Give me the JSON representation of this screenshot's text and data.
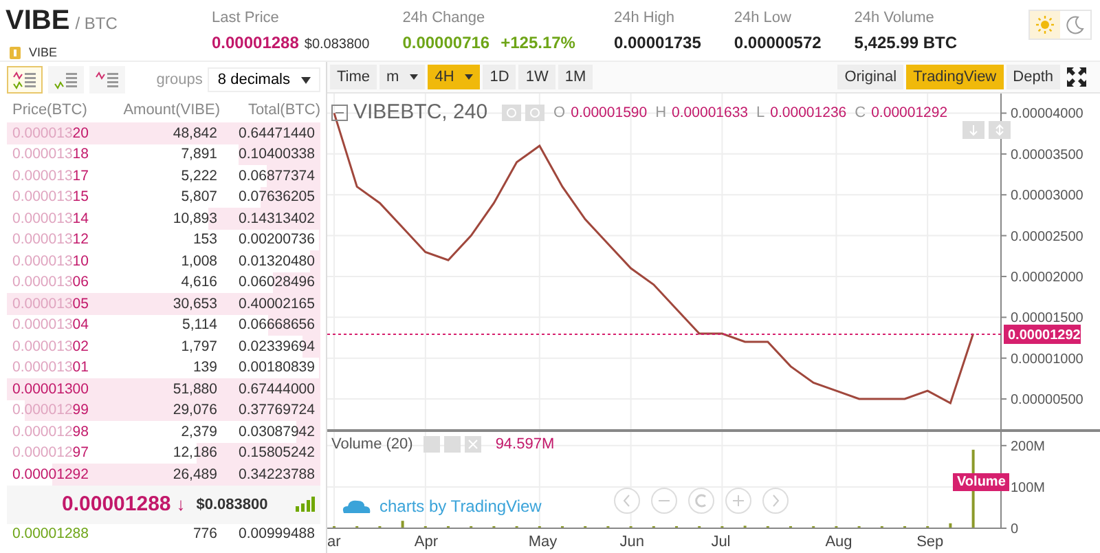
{
  "market": {
    "symbol": "VIBE",
    "quote": "/ BTC",
    "name": "VIBE"
  },
  "stats": [
    {
      "label": "Last Price",
      "value": "0.00001288",
      "extra": "$0.083800",
      "kind": "last"
    },
    {
      "label": "24h Change",
      "value": "0.00000716",
      "extra": "+125.17%",
      "kind": "change"
    },
    {
      "label": "24h High",
      "value": "0.00001735",
      "kind": "plain"
    },
    {
      "label": "24h Low",
      "value": "0.00000572",
      "kind": "plain"
    },
    {
      "label": "24h Volume",
      "value": "5,425.99 BTC",
      "kind": "plain"
    }
  ],
  "theme": [
    {
      "kind": "sun",
      "selected": true
    },
    {
      "kind": "moon",
      "selected": false
    }
  ],
  "orderbook": {
    "views": [
      {
        "kind": "both",
        "selected": true
      },
      {
        "kind": "buy",
        "selected": false
      },
      {
        "kind": "sell",
        "selected": false
      }
    ],
    "groups_label": "groups",
    "groups_value": "8 decimals",
    "columns": [
      "Price(BTC)",
      "Amount(VIBE)",
      "Total(BTC)"
    ],
    "asks": [
      {
        "price": "0.000013**20**",
        "amount": "48,842",
        "total": "0.64471440",
        "highlight": false
      },
      {
        "price": "0.000013**18**",
        "amount": "7,891",
        "total": "0.10400338",
        "highlight": false
      },
      {
        "price": "0.000013**17**",
        "amount": "5,222",
        "total": "0.06877374",
        "highlight": false
      },
      {
        "price": "0.000013**15**",
        "amount": "5,807",
        "total": "0.07636205",
        "highlight": false
      },
      {
        "price": "0.000013**14**",
        "amount": "10,893",
        "total": "0.14313402",
        "highlight": false
      },
      {
        "price": "0.000013**12**",
        "amount": "153",
        "total": "0.00200736",
        "highlight": false
      },
      {
        "price": "0.000013**10**",
        "amount": "1,008",
        "total": "0.01320480",
        "highlight": false
      },
      {
        "price": "0.000013**06**",
        "amount": "4,616",
        "total": "0.06028496",
        "highlight": false
      },
      {
        "price": "0.000013**05**",
        "amount": "30,653",
        "total": "0.40002165",
        "highlight": false
      },
      {
        "price": "0.000013**04**",
        "amount": "5,114",
        "total": "0.06668656",
        "highlight": false
      },
      {
        "price": "0.000013**02**",
        "amount": "1,797",
        "total": "0.02339694",
        "highlight": false
      },
      {
        "price": "0.000013**01**",
        "amount": "139",
        "total": "0.00180839",
        "highlight": false
      },
      {
        "price": "0.00001300",
        "amount": "51,880",
        "total": "0.67444000",
        "highlight": true
      },
      {
        "price": "0.000012**99**",
        "amount": "29,076",
        "total": "0.37769724",
        "highlight": false
      },
      {
        "price": "0.000012**98**",
        "amount": "2,379",
        "total": "0.03087942",
        "highlight": false
      },
      {
        "price": "0.000012**97**",
        "amount": "12,186",
        "total": "0.15805242",
        "highlight": false
      },
      {
        "price": "0.00001292",
        "amount": "26,489",
        "total": "0.34223788",
        "highlight": true
      }
    ],
    "last_price": "0.00001288",
    "arrow": "↓",
    "last_usd": "$0.083800",
    "bids": [
      {
        "price": "0.00001288",
        "amount": "776",
        "total": "0.00999488"
      }
    ]
  },
  "chart_toolbar": {
    "intervals": [
      {
        "label": "Time",
        "caret": false,
        "selected": false
      },
      {
        "label": "m",
        "caret": true,
        "selected": false
      },
      {
        "label": "4H",
        "caret": true,
        "selected": true
      },
      {
        "label": "1D",
        "caret": false,
        "selected": false
      },
      {
        "label": "1W",
        "caret": false,
        "selected": false
      },
      {
        "label": "1M",
        "caret": false,
        "selected": false
      }
    ],
    "views": [
      {
        "label": "Original",
        "selected": false
      },
      {
        "label": "TradingView",
        "selected": true
      },
      {
        "label": "Depth",
        "selected": false
      }
    ]
  },
  "legend": {
    "title": "VIBEBTC, 240",
    "ohlc": [
      {
        "key": "O",
        "value": "0.00001590"
      },
      {
        "key": "H",
        "value": "0.00001633"
      },
      {
        "key": "L",
        "value": "0.00001236"
      },
      {
        "key": "C",
        "value": "0.00001292"
      }
    ]
  },
  "price_chart": {
    "chart_data": {
      "type": "line",
      "grid": true,
      "series": [
        {
          "color": "#a0473c",
          "values": [
            4e-05,
            3.1e-05,
            2.9e-05,
            2.6e-05,
            2.3e-05,
            2.2e-05,
            2.5e-05,
            2.9e-05,
            3.4e-05,
            3.6e-05,
            3.1e-05,
            2.7e-05,
            2.4e-05,
            2.1e-05,
            1.9e-05,
            1.6e-05,
            1.3e-05,
            1.3e-05,
            1.2e-05,
            1.2e-05,
            9e-06,
            7e-06,
            6e-06,
            5e-06,
            5e-06,
            5e-06,
            6e-06,
            4.5e-06,
            1.3e-05
          ]
        }
      ],
      "ylim": [
        1.3e-06,
        4.24e-05
      ],
      "yticks": [
        {
          "value": 5e-06,
          "label": "0.00000500"
        },
        {
          "value": 1e-05,
          "label": "0.00001000"
        },
        {
          "value": 1.5e-05,
          "label": "0.00001500"
        },
        {
          "value": 2e-05,
          "label": "0.00002000"
        },
        {
          "value": 2.5e-05,
          "label": "0.00002500"
        },
        {
          "value": 3e-05,
          "label": "0.00003000"
        },
        {
          "value": 3.5e-05,
          "label": "0.00003500"
        },
        {
          "value": 4e-05,
          "label": "0.00004000"
        }
      ],
      "ref_lines": [
        {
          "axis": "y",
          "value": 1.292e-05,
          "label": "0.00001292",
          "color": "#d6206e"
        }
      ]
    }
  },
  "volume_chart": {
    "title": "Volume (20)",
    "reading": "94.597M",
    "branding": "charts by TradingView",
    "chart_data": {
      "type": "bar",
      "grid": true,
      "categories": [
        "ar",
        null,
        null,
        null,
        "Apr",
        null,
        null,
        null,
        null,
        "May",
        null,
        null,
        null,
        "Jun",
        null,
        null,
        null,
        "Jul",
        null,
        null,
        null,
        null,
        "Aug",
        null,
        null,
        null,
        "Sep",
        null,
        null
      ],
      "series": [
        {
          "name": "Volume",
          "color": "#8c9a2a",
          "values": [
            2,
            1,
            2,
            18,
            3,
            1,
            1,
            1,
            4,
            1,
            3,
            1,
            1,
            1,
            1,
            1,
            1,
            2,
            6,
            1,
            1,
            4,
            1,
            1,
            1,
            1,
            2,
            12,
            190
          ]
        }
      ],
      "ylim": [
        0,
        233
      ],
      "yticks": [
        {
          "value": 0,
          "label": "0"
        },
        {
          "value": 100,
          "label": "100M"
        },
        {
          "value": 200,
          "label": "200M"
        }
      ]
    }
  }
}
